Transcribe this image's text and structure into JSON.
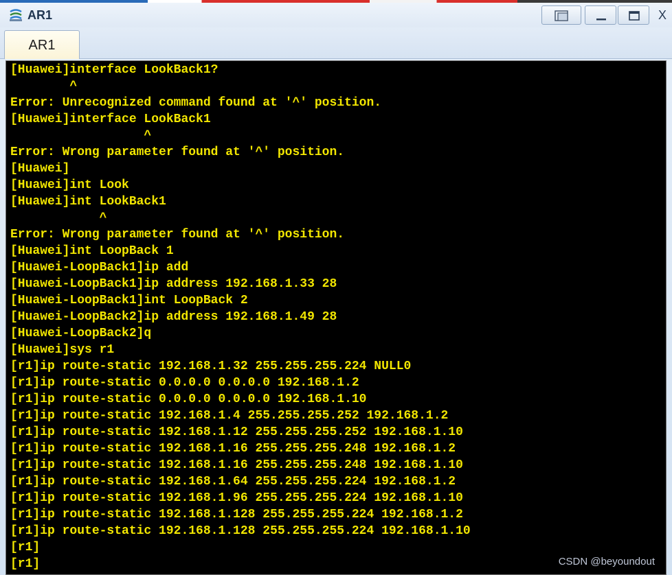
{
  "window": {
    "title": "AR1",
    "close_label": "X"
  },
  "tabs": [
    {
      "label": "AR1"
    }
  ],
  "terminal": {
    "lines": [
      "[Huawei]interface LookBack1?",
      "        ^",
      "Error: Unrecognized command found at '^' position.",
      "[Huawei]interface LookBack1",
      "                  ^",
      "Error: Wrong parameter found at '^' position.",
      "[Huawei]",
      "[Huawei]int Look",
      "[Huawei]int LookBack1",
      "            ^",
      "Error: Wrong parameter found at '^' position.",
      "[Huawei]int LoopBack 1",
      "[Huawei-LoopBack1]ip add",
      "[Huawei-LoopBack1]ip address 192.168.1.33 28",
      "[Huawei-LoopBack1]int LoopBack 2",
      "[Huawei-LoopBack2]ip address 192.168.1.49 28",
      "[Huawei-LoopBack2]q",
      "[Huawei]sys r1",
      "[r1]ip route-static 192.168.1.32 255.255.255.224 NULL0",
      "[r1]ip route-static 0.0.0.0 0.0.0.0 192.168.1.2",
      "[r1]ip route-static 0.0.0.0 0.0.0.0 192.168.1.10",
      "[r1]ip route-static 192.168.1.4 255.255.255.252 192.168.1.2",
      "[r1]ip route-static 192.168.1.12 255.255.255.252 192.168.1.10",
      "[r1]ip route-static 192.168.1.16 255.255.255.248 192.168.1.2",
      "[r1]ip route-static 192.168.1.16 255.255.255.248 192.168.1.10",
      "[r1]ip route-static 192.168.1.64 255.255.255.224 192.168.1.2",
      "[r1]ip route-static 192.168.1.96 255.255.255.224 192.168.1.10",
      "[r1]ip route-static 192.168.1.128 255.255.255.224 192.168.1.2",
      "[r1]ip route-static 192.168.1.128 255.255.255.224 192.168.1.10",
      "[r1]",
      "[r1]"
    ],
    "text_color": "#f2e600",
    "background": "#000000"
  },
  "watermark": "CSDN @beyoundout",
  "icons": {
    "app": "network-device-icon",
    "restore": "restore-icon",
    "minimize": "minimize-icon",
    "maximize": "maximize-icon"
  }
}
